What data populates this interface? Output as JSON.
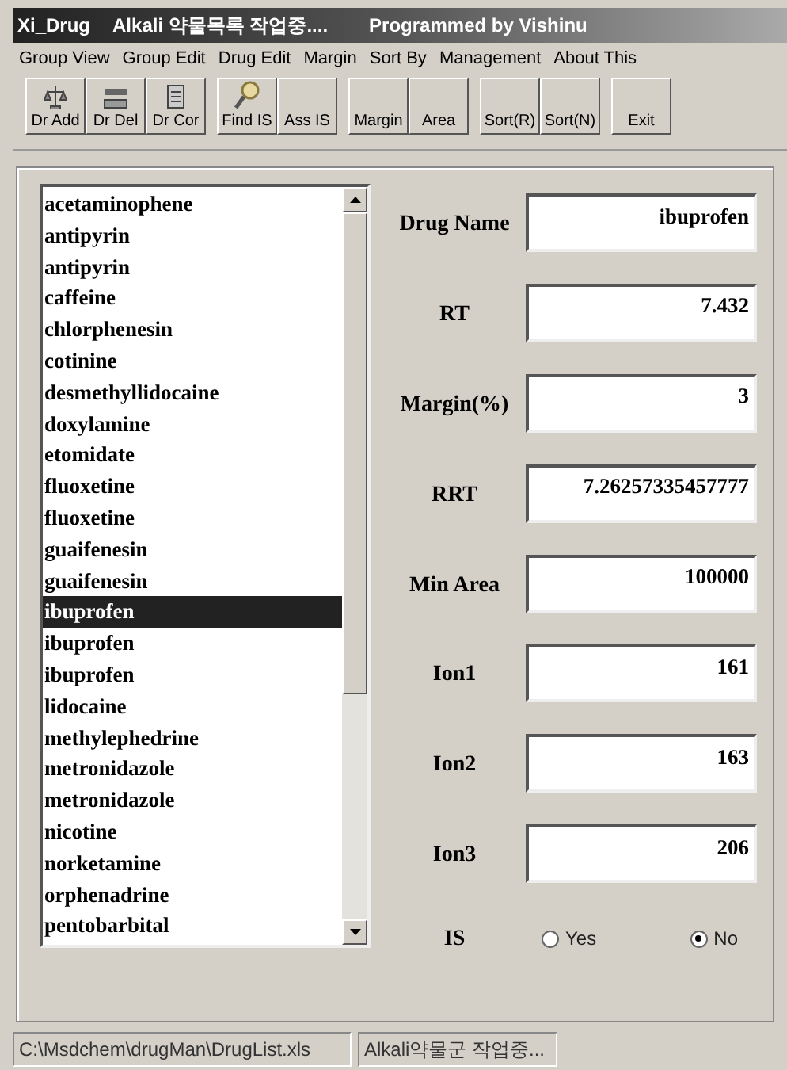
{
  "window": {
    "title_parts": [
      "Xi_Drug",
      "Alkali 약물목록 작업중....",
      "Programmed by Vishinu"
    ]
  },
  "menu": [
    "Group View",
    "Group Edit",
    "Drug Edit",
    "Margin",
    "Sort By",
    "Management",
    "About This"
  ],
  "toolbar": [
    [
      {
        "label": "Dr Add",
        "kind": "scale"
      },
      {
        "label": "Dr Del",
        "kind": "tray"
      },
      {
        "label": "Dr Cor",
        "kind": "doc"
      }
    ],
    [
      {
        "label": "Find IS",
        "kind": "search"
      },
      {
        "label": "Ass IS"
      }
    ],
    [
      {
        "label": "Margin"
      },
      {
        "label": "Area"
      }
    ],
    [
      {
        "label": "Sort(R)"
      },
      {
        "label": "Sort(N)"
      }
    ],
    [
      {
        "label": "Exit"
      }
    ]
  ],
  "drug_list": [
    {
      "name": "acetaminophene",
      "selected": false
    },
    {
      "name": "antipyrin",
      "selected": false
    },
    {
      "name": "antipyrin",
      "selected": false
    },
    {
      "name": "caffeine",
      "selected": false
    },
    {
      "name": "chlorphenesin",
      "selected": false
    },
    {
      "name": "cotinine",
      "selected": false
    },
    {
      "name": "desmethyllidocaine",
      "selected": false
    },
    {
      "name": "doxylamine",
      "selected": false
    },
    {
      "name": "etomidate",
      "selected": false
    },
    {
      "name": "fluoxetine",
      "selected": false
    },
    {
      "name": "fluoxetine",
      "selected": false
    },
    {
      "name": "guaifenesin",
      "selected": false
    },
    {
      "name": "guaifenesin",
      "selected": false
    },
    {
      "name": "ibuprofen",
      "selected": true
    },
    {
      "name": "ibuprofen",
      "selected": false
    },
    {
      "name": "ibuprofen",
      "selected": false
    },
    {
      "name": "lidocaine",
      "selected": false
    },
    {
      "name": "methylephedrine",
      "selected": false
    },
    {
      "name": "metronidazole",
      "selected": false
    },
    {
      "name": "metronidazole",
      "selected": false
    },
    {
      "name": "nicotine",
      "selected": false
    },
    {
      "name": "norketamine",
      "selected": false
    },
    {
      "name": "orphenadrine",
      "selected": false
    },
    {
      "name": "pentobarbital",
      "selected": false
    }
  ],
  "fields": [
    {
      "label": "Drug Name",
      "value": "ibuprofen"
    },
    {
      "label": "RT",
      "value": "7.432"
    },
    {
      "label": "Margin(%)",
      "value": "3"
    },
    {
      "label": "RRT",
      "value": "7.26257335457777"
    },
    {
      "label": "Min Area",
      "value": "100000"
    },
    {
      "label": "Ion1",
      "value": "161"
    },
    {
      "label": "Ion2",
      "value": "163"
    },
    {
      "label": "Ion3",
      "value": "206"
    }
  ],
  "is": {
    "label": "IS",
    "options": [
      {
        "label": "Yes",
        "selected": false
      },
      {
        "label": "No",
        "selected": true
      }
    ]
  },
  "status_bar": [
    "C:\\Msdchem\\drugMan\\DrugList.xls",
    "Alkali약물군 작업중..."
  ]
}
